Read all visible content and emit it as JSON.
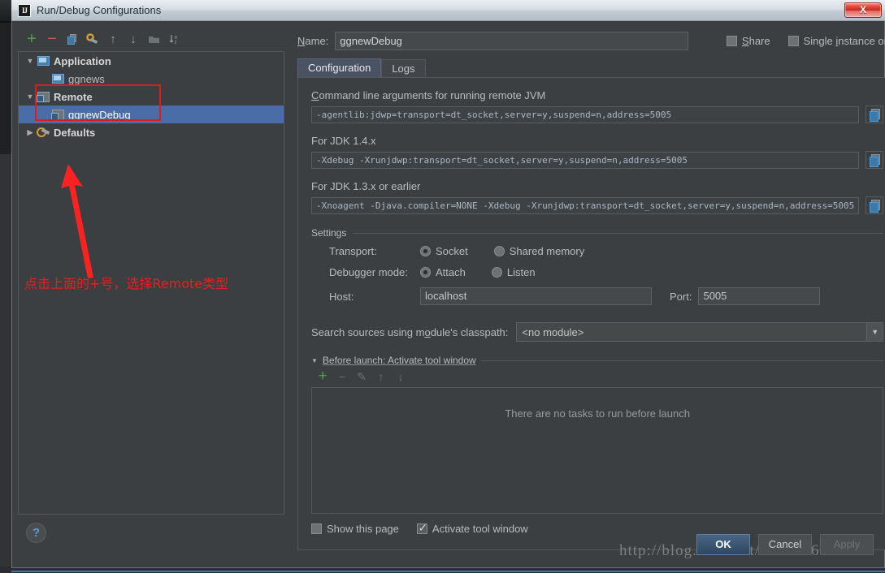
{
  "window": {
    "title": "Run/Debug Configurations",
    "app_icon": "IJ",
    "close_label": "X"
  },
  "tree_toolbar": {
    "buttons": [
      {
        "name": "add",
        "glyph": "+"
      },
      {
        "name": "remove",
        "glyph": "−"
      },
      {
        "name": "copy",
        "glyph": "❐"
      },
      {
        "name": "edit-defaults",
        "glyph": "⚙"
      },
      {
        "name": "move-up",
        "glyph": "↑"
      },
      {
        "name": "move-down",
        "glyph": "↓"
      },
      {
        "name": "new-folder",
        "glyph": "▰"
      },
      {
        "name": "sort-alphabetically",
        "glyph": "↓az"
      }
    ]
  },
  "tree": {
    "nodes": [
      {
        "label": "Application",
        "twisty": "▼",
        "level": 0,
        "icon": "application-icon",
        "selected": false,
        "bold": true
      },
      {
        "label": "ggnews",
        "twisty": "",
        "level": 1,
        "icon": "application-icon",
        "selected": false,
        "bold": false
      },
      {
        "label": "Remote",
        "twisty": "▼",
        "level": 0,
        "icon": "remote-icon",
        "selected": false,
        "bold": true
      },
      {
        "label": "ggnewDebug",
        "twisty": "",
        "level": 1,
        "icon": "remote-icon",
        "selected": true,
        "bold": false
      },
      {
        "label": "Defaults",
        "twisty": "▶",
        "level": 0,
        "icon": "wrench-icon",
        "selected": false,
        "bold": true
      }
    ]
  },
  "annotation": {
    "text": "点击上面的+号，选择Remote类型",
    "color": "#ee1c1c"
  },
  "help": {
    "label": "?"
  },
  "name_row": {
    "label": "Name:",
    "value": "ggnewDebug",
    "placeholder": "",
    "share_label": "Share",
    "share_checked": false,
    "single_instance_label": "Single instance only",
    "single_instance_checked": false
  },
  "tabs": [
    {
      "label": "Configuration",
      "active": true
    },
    {
      "label": "Logs",
      "active": false
    }
  ],
  "arguments": {
    "main_label": "Command line arguments for running remote JVM",
    "main_value": "-agentlib:jdwp=transport=dt_socket,server=y,suspend=n,address=5005",
    "jdk14_label": "For JDK 1.4.x",
    "jdk14_value": "-Xdebug -Xrunjdwp:transport=dt_socket,server=y,suspend=n,address=5005",
    "jdk13_label": "For JDK 1.3.x or earlier",
    "jdk13_value": "-Xnoagent -Djava.compiler=NONE -Xdebug -Xrunjdwp:transport=dt_socket,server=y,suspend=n,address=5005"
  },
  "settings": {
    "group_label": "Settings",
    "transport_label": "Transport:",
    "transport_options": [
      {
        "label": "Socket",
        "selected": true
      },
      {
        "label": "Shared memory",
        "selected": false
      }
    ],
    "debugger_mode_label": "Debugger mode:",
    "debugger_mode_options": [
      {
        "label": "Attach",
        "selected": true
      },
      {
        "label": "Listen",
        "selected": false
      }
    ],
    "host_label": "Host:",
    "host_value": "localhost",
    "port_label": "Port:",
    "port_value": "5005"
  },
  "classpath": {
    "label": "Search sources using module's classpath:",
    "value": "<no module>",
    "arrow": "▼"
  },
  "before_launch": {
    "header": "Before launch: Activate tool window",
    "twisty": "▼",
    "toolbar": [
      {
        "name": "add-task",
        "glyph": "+"
      },
      {
        "name": "remove-task",
        "glyph": "−"
      },
      {
        "name": "edit-task",
        "glyph": "✎"
      },
      {
        "name": "move-task-up",
        "glyph": "↑"
      },
      {
        "name": "move-task-down",
        "glyph": "↓"
      }
    ],
    "empty_text": "There are no tasks to run before launch",
    "show_page_label": "Show this page",
    "show_page_checked": false,
    "activate_tool_window_label": "Activate tool window",
    "activate_tool_window_checked": true
  },
  "footer": {
    "ok_label": "OK",
    "cancel_label": "Cancel",
    "apply_label": "Apply",
    "watermark": "http://blog.csdn.net/u013066244"
  },
  "colors": {
    "dialog_bg": "#3c3f41",
    "selection": "#4a6da7",
    "accent_green": "#4f9e4f",
    "annotation_red": "#ee1c1c",
    "mono_text": "#a9b7c6"
  }
}
